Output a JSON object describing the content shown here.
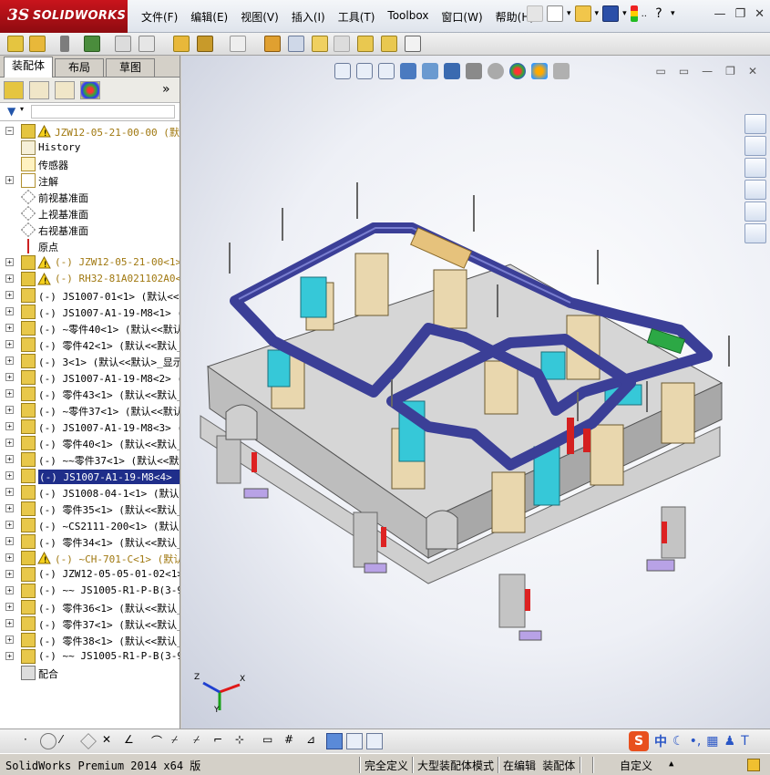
{
  "app": {
    "logo_ds": "3S",
    "logo_name": "SOLIDWORKS"
  },
  "menu": [
    "文件(F)",
    "编辑(E)",
    "视图(V)",
    "插入(I)",
    "工具(T)",
    "Toolbox",
    "窗口(W)",
    "帮助(H)"
  ],
  "panel": {
    "tabs": [
      "装配体",
      "布局",
      "草图"
    ],
    "more": "»"
  },
  "tree": {
    "root": "JZW12-05-21-00-00  (默认<显",
    "items": [
      {
        "label": "History",
        "icon": "history-icon"
      },
      {
        "label": "传感器",
        "icon": "sensor-icon"
      },
      {
        "label": "注解",
        "icon": "annotation-icon",
        "exp": "+"
      },
      {
        "label": "前视基准面",
        "icon": "plane-icon"
      },
      {
        "label": "上视基准面",
        "icon": "plane-icon"
      },
      {
        "label": "右视基准面",
        "icon": "plane-icon"
      },
      {
        "label": "原点",
        "icon": "origin-icon"
      },
      {
        "label": "(-) JZW12-05-21-00<1>",
        "icon": "subassembly-icon",
        "warn": true,
        "exp": "+"
      },
      {
        "label": "(-) RH32-81A021102A0<1>",
        "icon": "subassembly-icon",
        "warn": true,
        "exp": "+"
      },
      {
        "label": "(-) JS1007-01<1> (默认<<默",
        "icon": "part-icon",
        "exp": "+"
      },
      {
        "label": "(-) JS1007-A1-19-M8<1> (默",
        "icon": "part-icon",
        "exp": "+"
      },
      {
        "label": "(-) ~零件40<1> (默认<<默认",
        "icon": "part-icon",
        "exp": "+"
      },
      {
        "label": "(-) 零件42<1> (默认<<默认_",
        "icon": "part-icon",
        "exp": "+"
      },
      {
        "label": "(-) 3<1> (默认<<默认>_显示",
        "icon": "part-icon",
        "exp": "+"
      },
      {
        "label": "(-) JS1007-A1-19-M8<2> (默",
        "icon": "part-icon",
        "exp": "+"
      },
      {
        "label": "(-) 零件43<1> (默认<<默认_",
        "icon": "part-icon",
        "exp": "+"
      },
      {
        "label": "(-) ~零件37<1> (默认<<默认",
        "icon": "part-icon",
        "exp": "+"
      },
      {
        "label": "(-) JS1007-A1-19-M8<3> (默",
        "icon": "part-icon",
        "exp": "+"
      },
      {
        "label": "(-) 零件40<1> (默认<<默认_",
        "icon": "part-icon",
        "exp": "+"
      },
      {
        "label": "(-) ~~零件37<1> (默认<<默认",
        "icon": "part-icon",
        "exp": "+"
      },
      {
        "label": "(-) JS1007-A1-19-M8<4> (默",
        "icon": "part-icon",
        "exp": "+",
        "selected": true
      },
      {
        "label": "(-) JS1008-04-1<1> (默认<",
        "icon": "part-icon",
        "exp": "+"
      },
      {
        "label": "(-) 零件35<1> (默认<<默认_",
        "icon": "part-icon",
        "exp": "+"
      },
      {
        "label": "(-) ~CS2111-200<1> (默认<",
        "icon": "part-icon",
        "exp": "+"
      },
      {
        "label": "(-) 零件34<1> (默认<<默认_",
        "icon": "part-icon",
        "exp": "+"
      },
      {
        "label": "(-) ~CH-701-C<1> (默认<",
        "icon": "subassembly-icon",
        "warn": true,
        "exp": "+"
      },
      {
        "label": "(-) JZW12-05-05-01-02<1>",
        "icon": "part-icon",
        "exp": "+"
      },
      {
        "label": "(-) ~~  JS1005-R1-P-B(3-9)",
        "icon": "part-icon",
        "exp": "+"
      },
      {
        "label": "(-) 零件36<1> (默认<<默认_",
        "icon": "part-icon",
        "exp": "+"
      },
      {
        "label": "(-) 零件37<1> (默认<<默认_",
        "icon": "part-icon",
        "exp": "+"
      },
      {
        "label": "(-) 零件38<1> (默认<<默认_",
        "icon": "part-icon",
        "exp": "+"
      },
      {
        "label": "(-) ~~  JS1005-R1-P-B(3-9)",
        "icon": "part-icon",
        "exp": "+"
      },
      {
        "label": "配合",
        "icon": "mates-icon"
      }
    ]
  },
  "triad": {
    "x": "X",
    "y": "Y",
    "z": "Z"
  },
  "ime": {
    "lang": "中"
  },
  "status": {
    "product": "SolidWorks Premium 2014 x64 版",
    "defined": "完全定义",
    "mode": "大型装配体模式",
    "editing": "在编辑 装配体",
    "custom": "自定义"
  },
  "colors": {
    "logo_red": "#c9141c",
    "selection": "#1f2e8a",
    "rail_blue": "#3c3f96",
    "bracket_cyan": "#33c7d6",
    "base_gray": "#c8c8c8",
    "block_tan": "#e8d8b0"
  }
}
